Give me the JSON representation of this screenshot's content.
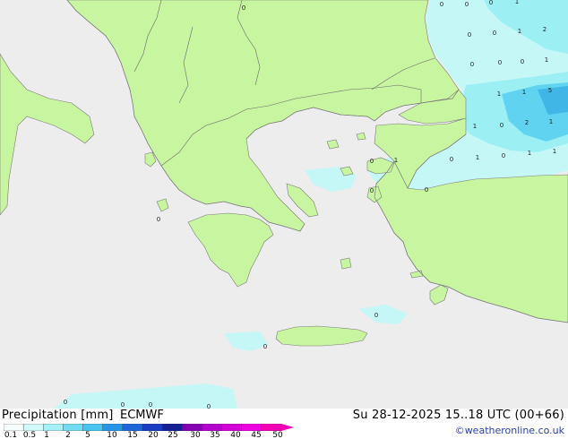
{
  "map": {
    "sea_color": "#ededed",
    "land_color": "#c8f5a0",
    "coast_color": "#7a7a7a",
    "precip_colors": {
      "light": "#c6f7f7",
      "mid": "#9cf0f4",
      "heavy": "#5fd3ef",
      "heavier": "#3fb6e6"
    },
    "precip_labels": [
      {
        "id": "bulgaria-0a",
        "text": "0"
      },
      {
        "id": "bulgaria-0b",
        "text": "0"
      },
      {
        "id": "bulgaria-0c",
        "text": "0"
      },
      {
        "id": "bulgaria-1a",
        "text": "1"
      },
      {
        "id": "bulgaria-0d",
        "text": "0"
      },
      {
        "id": "bulgaria-0e",
        "text": "0"
      },
      {
        "id": "bulgaria-1b",
        "text": "1"
      },
      {
        "id": "bulgaria-2",
        "text": "2"
      },
      {
        "id": "bulgaria-0f",
        "text": "0"
      },
      {
        "id": "bulgaria-0g",
        "text": "0"
      },
      {
        "id": "bulgaria-0h",
        "text": "0"
      },
      {
        "id": "bulgaria-1c",
        "text": "1"
      },
      {
        "id": "bulgaria-0i",
        "text": "0"
      },
      {
        "id": "marmara-1a",
        "text": "1"
      },
      {
        "id": "marmara-1b",
        "text": "1"
      },
      {
        "id": "marmara-5",
        "text": "5"
      },
      {
        "id": "marmara-1c",
        "text": "1"
      },
      {
        "id": "marmara-0a",
        "text": "0"
      },
      {
        "id": "marmara-2",
        "text": "2"
      },
      {
        "id": "marmara-1d",
        "text": "1"
      },
      {
        "id": "aegean-0a",
        "text": "0"
      },
      {
        "id": "aegean-1a",
        "text": "1"
      },
      {
        "id": "aegean-0b",
        "text": "0"
      },
      {
        "id": "aegean-1b",
        "text": "1"
      },
      {
        "id": "aegean-1c",
        "text": "1"
      },
      {
        "id": "aegean-0c",
        "text": "0"
      },
      {
        "id": "aegean-1d",
        "text": "1"
      },
      {
        "id": "aegean-0d",
        "text": "0"
      },
      {
        "id": "aegean-0e",
        "text": "0"
      },
      {
        "id": "albania-0",
        "text": "0"
      },
      {
        "id": "cyclades-0",
        "text": "0"
      },
      {
        "id": "crete-0",
        "text": "0"
      },
      {
        "id": "south-0a",
        "text": "0"
      },
      {
        "id": "south-0b",
        "text": "0"
      },
      {
        "id": "south-0c",
        "text": "0"
      },
      {
        "id": "south-0d",
        "text": "0"
      }
    ]
  },
  "footer": {
    "title": "Precipitation [mm]",
    "model": "ECMWF",
    "valid": "Su 28-12-2025 15..18 UTC (00+66)",
    "credit": "©weatheronline.co.uk"
  },
  "legend": {
    "ticks": [
      "0.1",
      "0.5",
      "1",
      "2",
      "5",
      "10",
      "15",
      "20",
      "25",
      "30",
      "35",
      "40",
      "45",
      "50"
    ],
    "colors": [
      "#f5fdfd",
      "#d2fafa",
      "#a6f0f7",
      "#74dcf2",
      "#48c4ee",
      "#2896e6",
      "#1e66d8",
      "#1a3cc2",
      "#152194",
      "#8400b0",
      "#b400cc",
      "#d400d8",
      "#ec00e0",
      "#f400b4"
    ]
  }
}
